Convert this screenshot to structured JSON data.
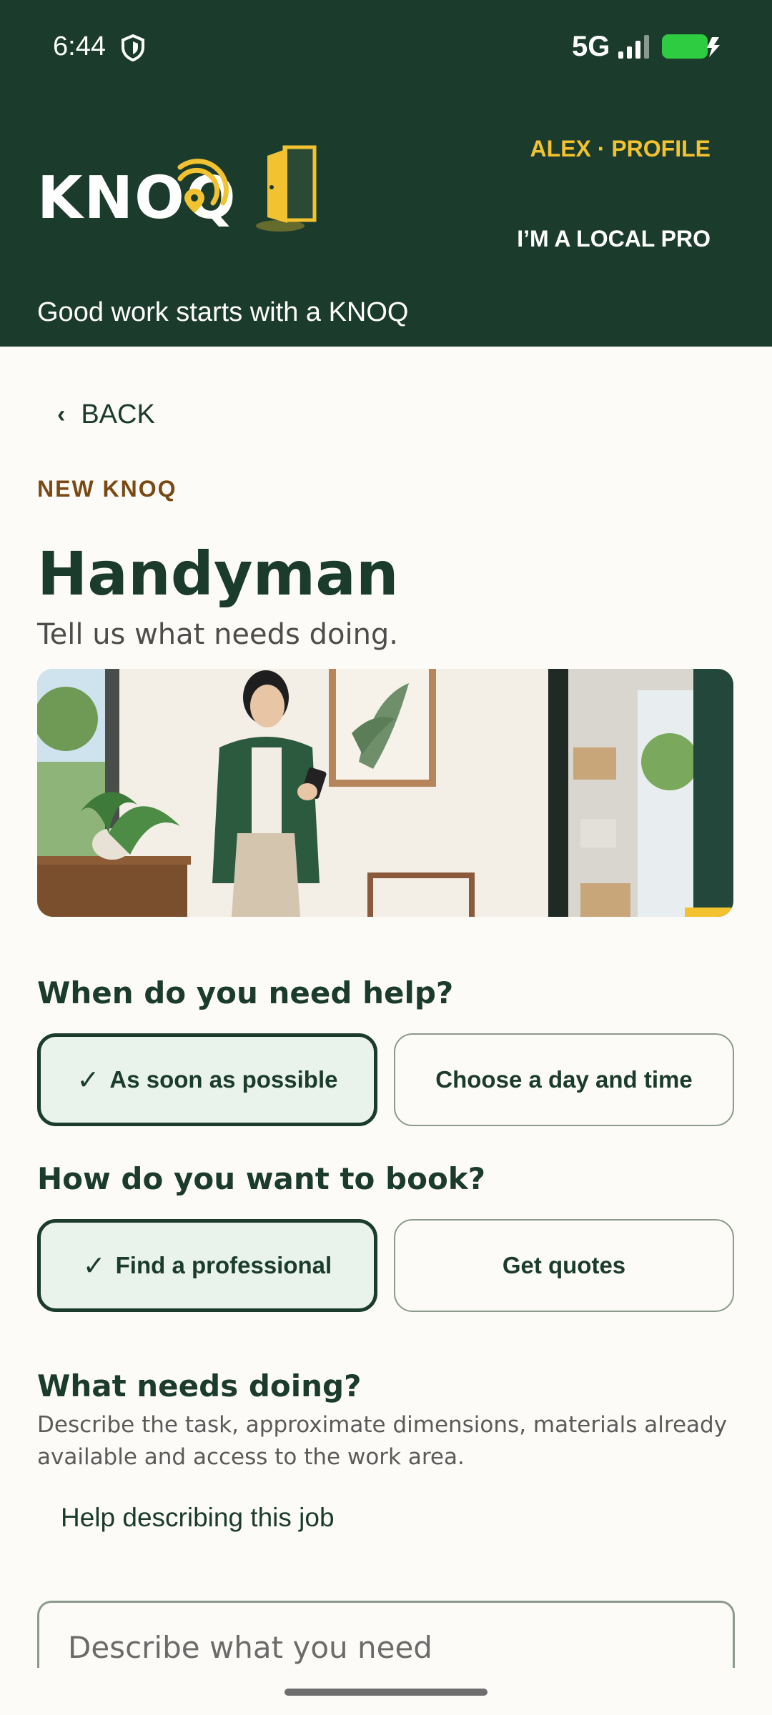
{
  "status_bar": {
    "time": "6:44",
    "network": "5G",
    "shield_icon": "shield-icon",
    "signal_icon": "signal-icon",
    "battery_icon": "battery-charging-icon",
    "battery_color": "#2ecc40"
  },
  "header": {
    "logo_text": "KNOQ",
    "profile_link": "ALEX · PROFILE",
    "pro_link": "I’M A LOCAL PRO",
    "tagline": "Good work starts with a KNOQ",
    "colors": {
      "background": "#1b3b2c",
      "accent": "#f2c230"
    }
  },
  "nav": {
    "back_label": "BACK",
    "back_icon": "chevron-left-icon"
  },
  "page": {
    "eyebrow": "NEW KNOQ",
    "title": "Handyman",
    "subtitle": "Tell us what needs doing."
  },
  "when": {
    "question": "When do you need help?",
    "options": [
      {
        "label": "As soon as possible",
        "selected": true
      },
      {
        "label": "Choose a day and time",
        "selected": false
      }
    ]
  },
  "booking": {
    "question": "How do you want to book?",
    "options": [
      {
        "label": "Find a professional",
        "selected": true
      },
      {
        "label": "Get quotes",
        "selected": false
      }
    ]
  },
  "details": {
    "question": "What needs doing?",
    "help_text": "Describe the task, approximate dimensions, materials already available and access to the work area.",
    "help_link": "Help describing this job",
    "placeholder": "Describe what you need"
  },
  "check_mark": "✓"
}
